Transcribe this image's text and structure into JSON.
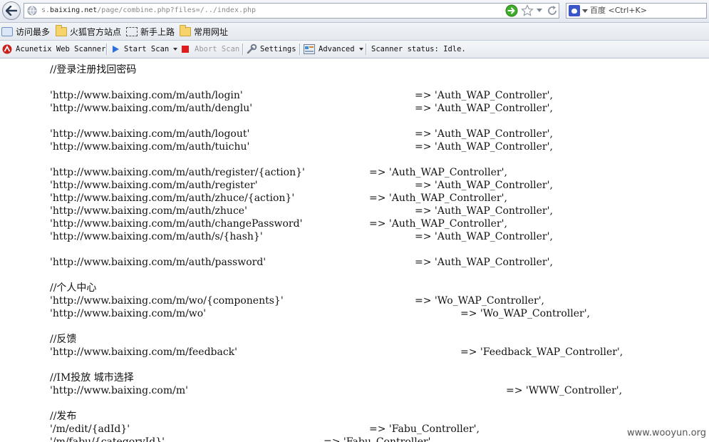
{
  "browser": {
    "url_gray_prefix": "s.",
    "url_domain": "baixing.net",
    "url_path": "/page/combine.php?files=/../index.php",
    "search_engine": "百度",
    "search_placeholder": "百度 <Ctrl+K>"
  },
  "bookmarks": [
    {
      "label": "访问最多",
      "icon": "magnifier-icon"
    },
    {
      "label": "火狐官方站点",
      "icon": "folder-icon"
    },
    {
      "label": "新手上路",
      "icon": "dashed-box-icon"
    },
    {
      "label": "常用网址",
      "icon": "folder-icon"
    }
  ],
  "acunetix": {
    "logo_label": "Acunetix Web Scanner",
    "start_scan": "Start Scan",
    "abort_scan": "Abort Scan",
    "settings": "Settings",
    "advanced": "Advanced",
    "status": "Scanner status: Idle."
  },
  "code_lines": [
    "//登录注册找回密码",
    "'http://www.baixing.com/m/auth/login'",
    "=> 'Auth_WAP_Controller',",
    "'http://www.baixing.com/m/auth/denglu'",
    "=> 'Auth_WAP_Controller',",
    "'http://www.baixing.com/m/auth/logout'",
    "=> 'Auth_WAP_Controller',",
    "'http://www.baixing.com/m/auth/tuichu'",
    "=> 'Auth_WAP_Controller',",
    "'http://www.baixing.com/m/auth/register/{action}'",
    "=> 'Auth_WAP_Controller',",
    "'http://www.baixing.com/m/auth/register'",
    "=> 'Auth_WAP_Controller',",
    "'http://www.baixing.com/m/auth/zhuce/{action}'",
    "=> 'Auth_WAP_Controller',",
    "'http://www.baixing.com/m/auth/zhuce'",
    "=> 'Auth_WAP_Controller',",
    "'http://www.baixing.com/m/auth/changePassword'",
    "=> 'Auth_WAP_Controller',",
    "'http://www.baixing.com/m/auth/s/{hash}'",
    "=> 'Auth_WAP_Controller',",
    "'http://www.baixing.com/m/auth/password'",
    "=> 'Auth_WAP_Controller',",
    "//个人中心",
    "'http://www.baixing.com/m/wo/{components}'",
    "=> 'Wo_WAP_Controller',",
    "'http://www.baixing.com/m/wo'",
    "=> 'Wo_WAP_Controller',",
    "//反馈",
    "'http://www.baixing.com/m/feedback'",
    "=> 'Feedback_WAP_Controller',",
    "//IM投放 城市选择",
    "'http://www.baixing.com/m'",
    "=> 'WWW_Controller',",
    "//发布",
    "'/m/edit/{adId}'",
    "=> 'Fabu_Controller',",
    "'/m/fabu/{categoryId}'",
    "=> 'Fabu_Controller',"
  ],
  "watermark": "www.wooyun.org"
}
